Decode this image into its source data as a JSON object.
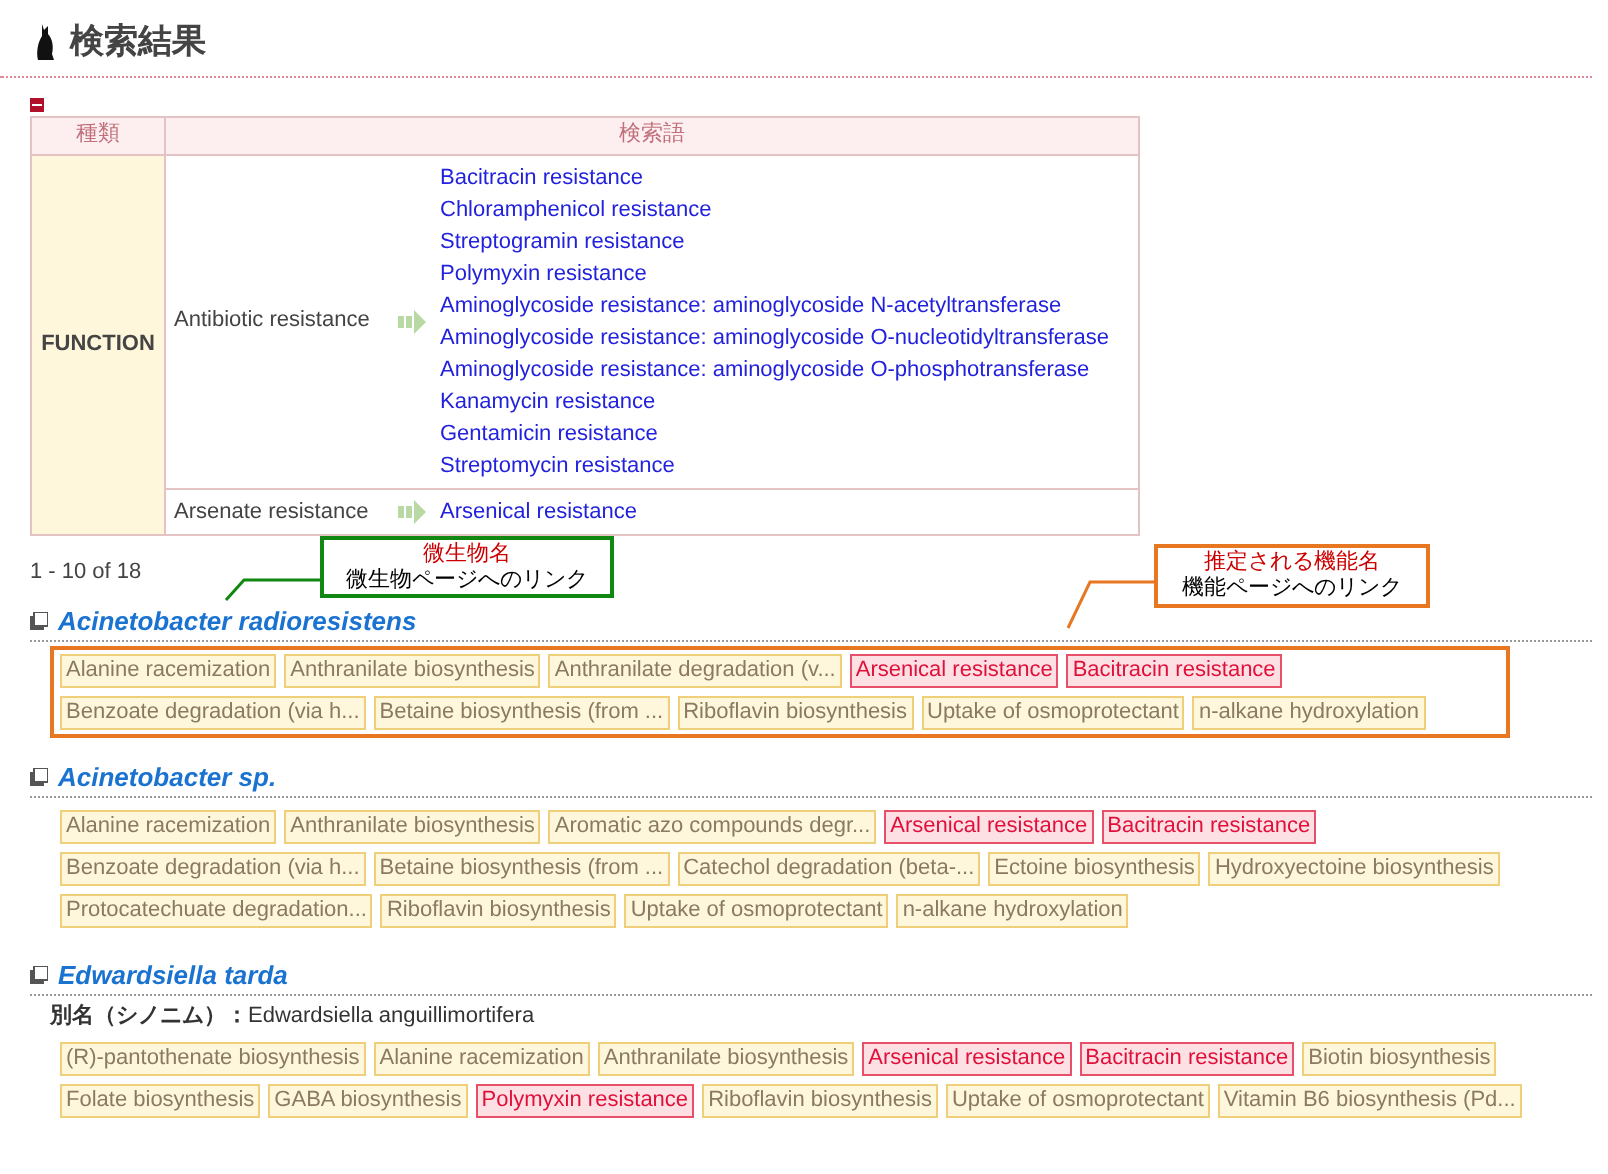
{
  "title": "検索結果",
  "query_table": {
    "columns": [
      "種類",
      "検索語"
    ],
    "category": "FUNCTION",
    "rows": [
      {
        "term": "Antibiotic resistance",
        "links": [
          "Bacitracin resistance",
          "Chloramphenicol resistance",
          "Streptogramin resistance",
          "Polymyxin resistance",
          "Aminoglycoside resistance: aminoglycoside N-acetyltransferase",
          "Aminoglycoside resistance: aminoglycoside O-nucleotidyltransferase",
          "Aminoglycoside resistance: aminoglycoside O-phosphotransferase",
          "Kanamycin resistance",
          "Gentamicin resistance",
          "Streptomycin resistance"
        ]
      },
      {
        "term": "Arsenate resistance",
        "links": [
          "Arsenical resistance"
        ]
      }
    ]
  },
  "result_count": "1 - 10 of 18",
  "callouts": [
    {
      "title": "微生物名",
      "text": "微生物ページへのリンク",
      "color": "#118811"
    },
    {
      "title": "推定される機能名",
      "text": "機能ページへのリンク",
      "color": "#e87722"
    }
  ],
  "organisms": [
    {
      "name": "Acinetobacter radioresistens",
      "outlined": true,
      "rows": [
        [
          {
            "label": "Alanine racemization",
            "highlighted": false
          },
          {
            "label": "Anthranilate biosynthesis",
            "highlighted": false
          },
          {
            "label": "Anthranilate degradation (v...",
            "highlighted": false
          },
          {
            "label": "Arsenical resistance",
            "highlighted": true
          },
          {
            "label": "Bacitracin resistance",
            "highlighted": true
          }
        ],
        [
          {
            "label": "Benzoate degradation (via h...",
            "highlighted": false
          },
          {
            "label": "Betaine biosynthesis (from ...",
            "highlighted": false
          },
          {
            "label": "Riboflavin biosynthesis",
            "highlighted": false
          },
          {
            "label": "Uptake of osmoprotectant",
            "highlighted": false
          },
          {
            "label": "n-alkane hydroxylation",
            "highlighted": false
          }
        ]
      ]
    },
    {
      "name": "Acinetobacter sp.",
      "outlined": false,
      "rows": [
        [
          {
            "label": "Alanine racemization",
            "highlighted": false
          },
          {
            "label": "Anthranilate biosynthesis",
            "highlighted": false
          },
          {
            "label": "Aromatic azo compounds degr...",
            "highlighted": false
          },
          {
            "label": "Arsenical resistance",
            "highlighted": true
          },
          {
            "label": "Bacitracin resistance",
            "highlighted": true
          }
        ],
        [
          {
            "label": "Benzoate degradation (via h...",
            "highlighted": false
          },
          {
            "label": "Betaine biosynthesis (from ...",
            "highlighted": false
          },
          {
            "label": "Catechol degradation (beta-...",
            "highlighted": false
          },
          {
            "label": "Ectoine biosynthesis",
            "highlighted": false
          },
          {
            "label": "Hydroxyectoine biosynthesis",
            "highlighted": false
          }
        ],
        [
          {
            "label": "Protocatechuate degradation...",
            "highlighted": false
          },
          {
            "label": "Riboflavin biosynthesis",
            "highlighted": false
          },
          {
            "label": "Uptake of osmoprotectant",
            "highlighted": false
          },
          {
            "label": "n-alkane hydroxylation",
            "highlighted": false
          }
        ]
      ]
    },
    {
      "name": "Edwardsiella tarda",
      "outlined": false,
      "synonym_label": "別名（シノニム）：",
      "synonym": "Edwardsiella anguillimortifera",
      "rows": [
        [
          {
            "label": "(R)-pantothenate biosynthesis",
            "highlighted": false
          },
          {
            "label": "Alanine racemization",
            "highlighted": false
          },
          {
            "label": "Anthranilate biosynthesis",
            "highlighted": false
          },
          {
            "label": "Arsenical resistance",
            "highlighted": true
          },
          {
            "label": "Bacitracin resistance",
            "highlighted": true
          },
          {
            "label": "Biotin biosynthesis",
            "highlighted": false
          }
        ],
        [
          {
            "label": "Folate biosynthesis",
            "highlighted": false
          },
          {
            "label": "GABA biosynthesis",
            "highlighted": false
          },
          {
            "label": "Polymyxin resistance",
            "highlighted": true
          },
          {
            "label": "Riboflavin biosynthesis",
            "highlighted": false
          },
          {
            "label": "Uptake of osmoprotectant",
            "highlighted": false
          },
          {
            "label": "Vitamin B6 biosynthesis (Pd...",
            "highlighted": false
          }
        ]
      ]
    }
  ]
}
